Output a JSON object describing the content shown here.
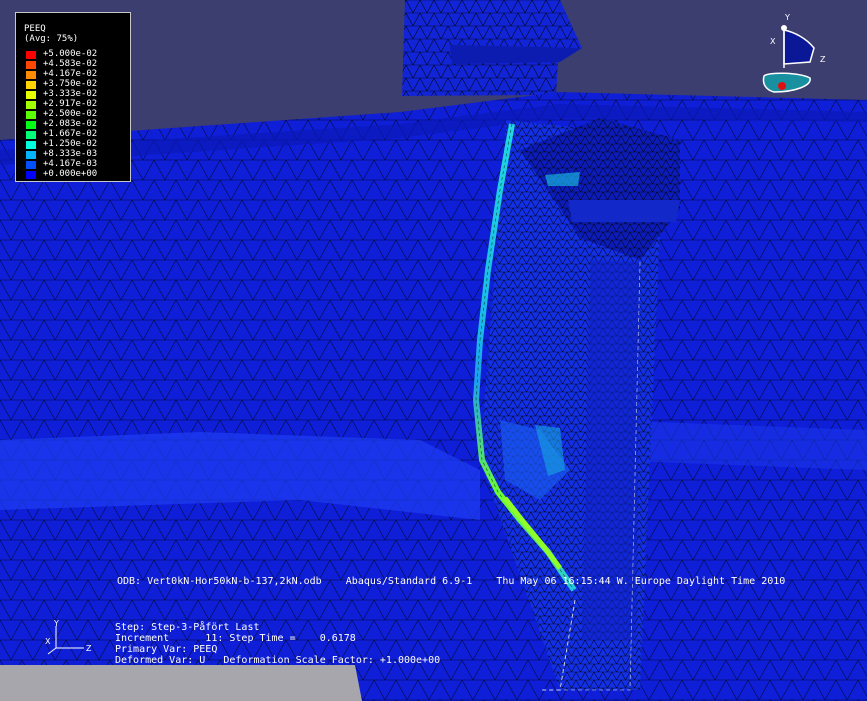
{
  "legend": {
    "title": "PEEQ",
    "subtitle": "(Avg: 75%)",
    "levels": [
      {
        "value": "+5.000e-02",
        "color": "#ff0000"
      },
      {
        "value": "+4.583e-02",
        "color": "#ff4600"
      },
      {
        "value": "+4.167e-02",
        "color": "#ff8c00"
      },
      {
        "value": "+3.750e-02",
        "color": "#ffd200"
      },
      {
        "value": "+3.333e-02",
        "color": "#e6ff00"
      },
      {
        "value": "+2.917e-02",
        "color": "#a0ff00"
      },
      {
        "value": "+2.500e-02",
        "color": "#5aff00"
      },
      {
        "value": "+2.083e-02",
        "color": "#00ff14"
      },
      {
        "value": "+1.667e-02",
        "color": "#00ff78"
      },
      {
        "value": "+1.250e-02",
        "color": "#00ffdc"
      },
      {
        "value": "+8.333e-03",
        "color": "#00b4ff"
      },
      {
        "value": "+4.167e-03",
        "color": "#0050ff"
      },
      {
        "value": "+0.000e+00",
        "color": "#0000ff"
      }
    ]
  },
  "status_line": "ODB: Vert0kN-Hor50kN-b-137,2kN.odb    Abaqus/Standard 6.9-1    Thu May 06 16:15:44 W. Europe Daylight Time 2010",
  "step_info": {
    "step": "Step: Step-3-Påfört Last",
    "increment": "Increment      11: Step Time =    0.6178",
    "primary_var": "Primary Var: PEEQ",
    "deformed_var": "Deformed Var: U   Deformation Scale Factor: +1.000e+00"
  },
  "view_triad": {
    "y": "Y",
    "x": "X",
    "z": "Z"
  },
  "small_triad": {
    "y": "Y",
    "x": "X",
    "z": "Z"
  },
  "colors": {
    "background": "#3c3e70",
    "mesh_blue": "#0f1fd8",
    "mesh_blue_dark": "#0718a8",
    "mesh_blue_light": "#1c3aee",
    "mesh_line": "#000000",
    "highlight_cyan": "#1ec8d8",
    "highlight_green": "#8cff20"
  }
}
